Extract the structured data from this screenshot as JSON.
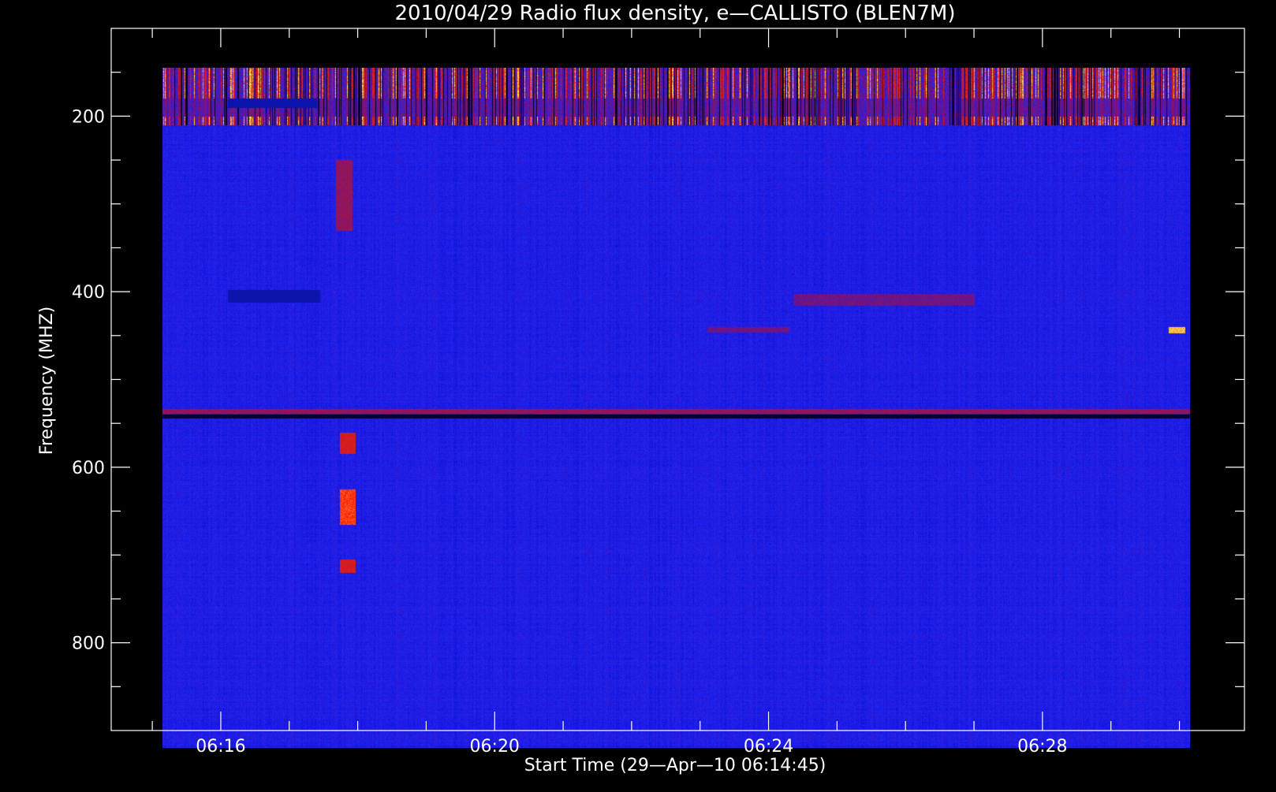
{
  "chart_data": {
    "type": "heatmap",
    "title": "2010/04/29  Radio flux density, e—CALLISTO (BLEN7M)",
    "xlabel": "Start Time (29—Apr—10 06:14:45)",
    "ylabel": "Frequency (MHZ)",
    "x_unit": "minutes",
    "xlim": [
      14.4,
      30.95
    ],
    "x_data_range": [
      15.15,
      30.15
    ],
    "x_major_ticks": [
      {
        "value": 16,
        "label": "06:16"
      },
      {
        "value": 20,
        "label": "06:20"
      },
      {
        "value": 24,
        "label": "06:24"
      },
      {
        "value": 28,
        "label": "06:28"
      }
    ],
    "x_minor_step": 1,
    "ylim": [
      100,
      900
    ],
    "y_data_range": [
      145,
      920
    ],
    "y_inverted": true,
    "y_major_ticks": [
      200,
      400,
      600,
      800
    ],
    "y_minor_step": 50,
    "colormap": [
      "#000000",
      "#1a006b",
      "#0a14e0",
      "#2a30ff",
      "#8a1040",
      "#c81010",
      "#ff2000",
      "#ff8800",
      "#ffff40"
    ],
    "background_color": "#2020f0",
    "features": [
      {
        "kind": "interference_band",
        "f_min": 145,
        "f_max": 210,
        "intensity": "high"
      },
      {
        "kind": "dark_patch",
        "t_start": 16.1,
        "t_end": 17.45,
        "f_min": 398,
        "f_max": 412
      },
      {
        "kind": "dark_patch",
        "t_start": 16.1,
        "t_end": 17.4,
        "f_min": 180,
        "f_max": 190
      },
      {
        "kind": "burst",
        "t": 17.8,
        "f_min": 250,
        "f_max": 330,
        "intensity": "low"
      },
      {
        "kind": "burst",
        "t": 17.85,
        "f_min": 560,
        "f_max": 585,
        "intensity": "medium"
      },
      {
        "kind": "burst",
        "t": 17.85,
        "f_min": 625,
        "f_max": 665,
        "intensity": "high"
      },
      {
        "kind": "burst",
        "t": 17.85,
        "f_min": 705,
        "f_max": 720,
        "intensity": "medium"
      },
      {
        "kind": "horizontal_line",
        "f": 536,
        "intensity": "medium"
      },
      {
        "kind": "horizontal_line",
        "f": 542,
        "intensity": "dark"
      },
      {
        "kind": "patch",
        "t_start": 23.1,
        "t_end": 24.3,
        "f_min": 440,
        "f_max": 446,
        "intensity": "low"
      },
      {
        "kind": "patch",
        "t_start": 24.35,
        "t_end": 27.0,
        "f_min": 402,
        "f_max": 416,
        "intensity": "low"
      },
      {
        "kind": "spot",
        "t": 29.95,
        "f_min": 440,
        "f_max": 447,
        "intensity": "high"
      }
    ]
  }
}
